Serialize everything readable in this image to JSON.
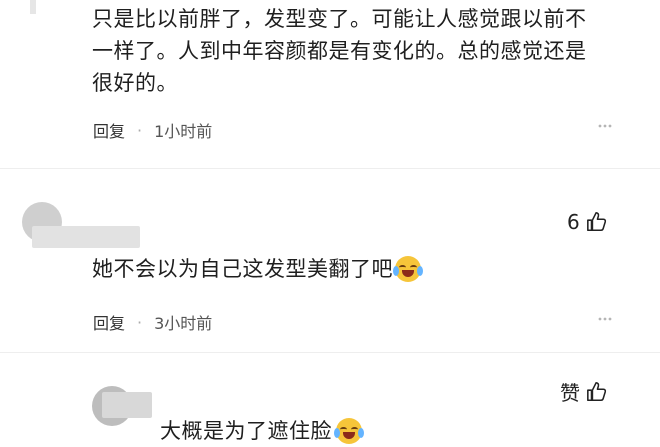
{
  "comments": [
    {
      "text_lines": [
        "只是比以前胖了，发型变了。可能让人感觉跟以前不",
        "一样了。人到中年容颜都是有变化的。总的感觉还是",
        "很好的。"
      ],
      "reply_label": "回复",
      "separator": "·",
      "time": "1小时前"
    },
    {
      "likes": "6",
      "text": "她不会以为自己这发型美翻了吧",
      "emoji": "laugh-cry-emoji",
      "reply_label": "回复",
      "separator": "·",
      "time": "3小时前"
    },
    {
      "like_label": "赞",
      "text": "大概是为了遮住脸",
      "emoji": "laugh-cry-emoji"
    }
  ],
  "more_icon": "more-dots-icon",
  "thumb_icon": "thumbs-up-icon",
  "colors": {
    "text": "#1f1f1f",
    "meta": "#555555",
    "emoji": "#f6c53a"
  }
}
